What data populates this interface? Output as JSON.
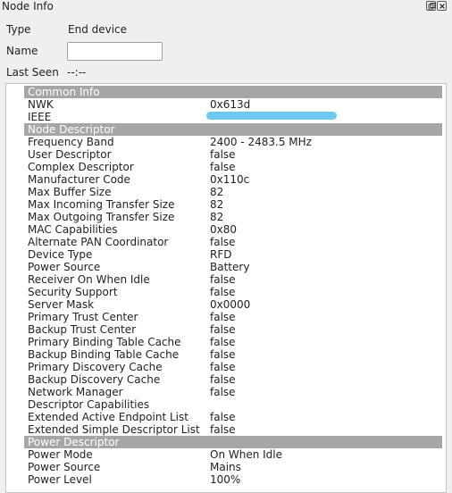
{
  "panel": {
    "title": "Node Info",
    "float_button": "float-button",
    "close_button": "close-button"
  },
  "fields": {
    "type_label": "Type",
    "type_value": "End device",
    "name_label": "Name",
    "name_value": "",
    "last_seen_label": "Last Seen",
    "last_seen_value": "--:--"
  },
  "tree": {
    "sections": [
      {
        "title": "Common Info",
        "rows": [
          {
            "key": "NWK",
            "value": "0x613d"
          },
          {
            "key": "IEEE",
            "value": ""
          }
        ]
      },
      {
        "title": "Node Descriptor",
        "rows": [
          {
            "key": "Frequency Band",
            "value": "2400 - 2483.5 MHz"
          },
          {
            "key": "User Descriptor",
            "value": "false"
          },
          {
            "key": "Complex Descriptor",
            "value": "false"
          },
          {
            "key": "Manufacturer Code",
            "value": "0x110c"
          },
          {
            "key": "Max Buffer Size",
            "value": "82"
          },
          {
            "key": "Max Incoming Transfer Size",
            "value": "82"
          },
          {
            "key": "Max Outgoing Transfer Size",
            "value": "82"
          },
          {
            "key": "MAC Capabilities",
            "value": "0x80"
          },
          {
            "key": "Alternate PAN Coordinator",
            "value": "false"
          },
          {
            "key": "Device Type",
            "value": "RFD"
          },
          {
            "key": "Power Source",
            "value": "Battery"
          },
          {
            "key": "Receiver On When Idle",
            "value": "false"
          },
          {
            "key": "Security Support",
            "value": "false"
          },
          {
            "key": "Server Mask",
            "value": "0x0000"
          },
          {
            "key": "Primary Trust Center",
            "value": "false"
          },
          {
            "key": "Backup Trust Center",
            "value": "false"
          },
          {
            "key": "Primary Binding Table Cache",
            "value": "false"
          },
          {
            "key": "Backup Binding Table Cache",
            "value": "false"
          },
          {
            "key": "Primary Discovery Cache",
            "value": "false"
          },
          {
            "key": "Backup Discovery Cache",
            "value": "false"
          },
          {
            "key": "Network Manager",
            "value": "false"
          },
          {
            "key": "Descriptor Capabilities",
            "value": ""
          },
          {
            "key": "Extended Active Endpoint List",
            "value": "false"
          },
          {
            "key": "Extended Simple Descriptor List",
            "value": "false"
          }
        ]
      },
      {
        "title": "Power Descriptor",
        "rows": [
          {
            "key": "Power Mode",
            "value": "On When Idle"
          },
          {
            "key": "Power Source",
            "value": "Mains"
          },
          {
            "key": "Power Level",
            "value": "100%"
          }
        ]
      }
    ]
  },
  "colors": {
    "section_header_bg": "#a6a6a6",
    "redaction": "#6fc9ef"
  }
}
